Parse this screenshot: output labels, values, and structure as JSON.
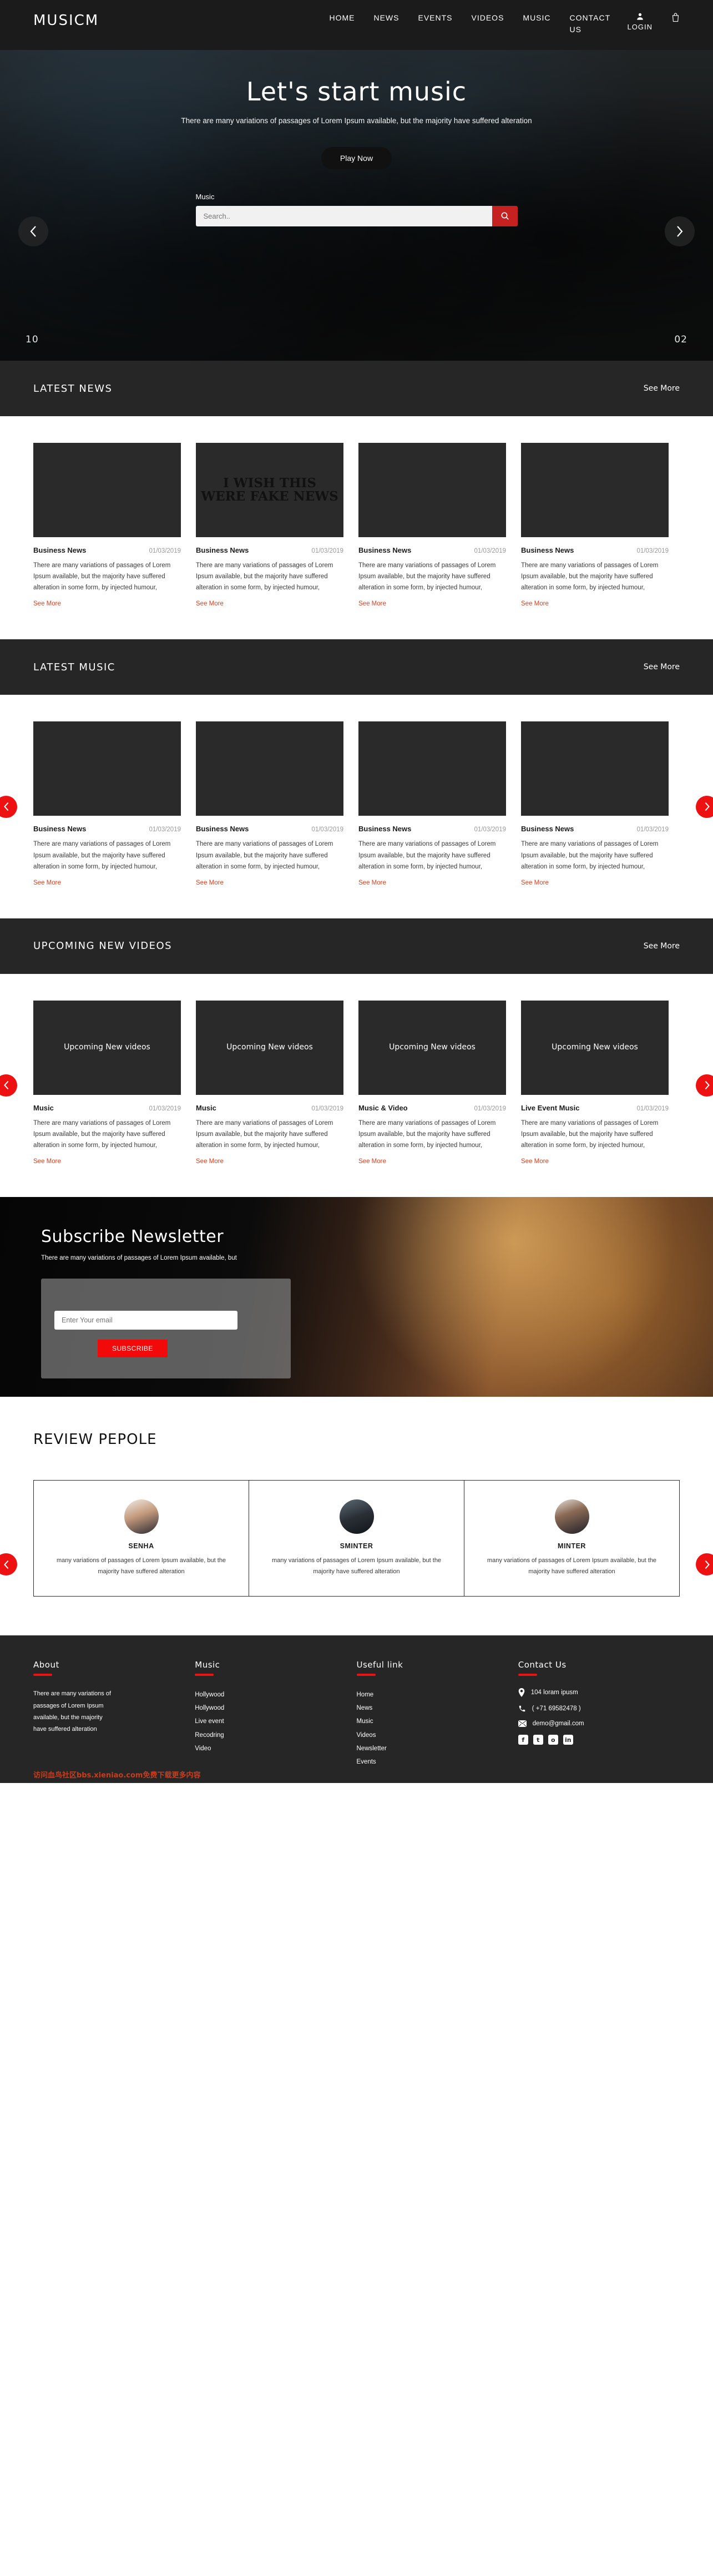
{
  "header": {
    "brand": "MUSICM",
    "nav": [
      {
        "label": "HOME"
      },
      {
        "label": "NEWS"
      },
      {
        "label": "EVENTS"
      },
      {
        "label": "VIDEOS"
      },
      {
        "label": "MUSIC"
      },
      {
        "label": "CONTACT US"
      }
    ],
    "account_label": "LOGIN",
    "account_icon": "user-icon",
    "cart_icon": "shopping-bag-icon"
  },
  "hero": {
    "title": "Let's start music",
    "subtitle": "There are many variations of passages of Lorem Ipsum available, but the majority have suffered alteration",
    "play_label": "Play Now",
    "search_label": "Music",
    "search_placeholder": "Search..",
    "search_value": "",
    "search_icon": "search-icon",
    "prev_icon": "chevron-left-icon",
    "next_icon": "chevron-right-icon",
    "slide_current": "10",
    "slide_total": "02"
  },
  "news_section": {
    "title": "LATEST NEWS",
    "more_label": "See More",
    "cards": [
      {
        "title": "Business News",
        "date": "01/03/2019",
        "body": "There are many variations of passages of Lorem Ipsum available, but the majority have suffered alteration in some form, by injected humour,",
        "link": "See More",
        "thumb": "newspaper-photo",
        "overlay": ""
      },
      {
        "title": "Business News",
        "date": "01/03/2019",
        "body": "There are many variations of passages of Lorem Ipsum available, but the majority have suffered alteration in some form, by injected humour,",
        "link": "See More",
        "thumb": "protest-sign-photo",
        "overlay": "I WISH THIS WERE FAKE NEWS"
      },
      {
        "title": "Business News",
        "date": "01/03/2019",
        "body": "There are many variations of passages of Lorem Ipsum available, but the majority have suffered alteration in some form, by injected humour,",
        "link": "See More",
        "thumb": "mixing-console-photo",
        "overlay": ""
      },
      {
        "title": "Business News",
        "date": "01/03/2019",
        "body": "There are many variations of passages of Lorem Ipsum available, but the majority have suffered alteration in some form, by injected humour,",
        "link": "See More",
        "thumb": "podcast-studio-photo",
        "overlay": ""
      }
    ]
  },
  "music_section": {
    "title": "LATEST MUSIC",
    "more_label": "See More",
    "prev_icon": "chevron-left-icon",
    "next_icon": "chevron-right-icon",
    "cards": [
      {
        "title": "Business News",
        "date": "01/03/2019",
        "body": "There are many variations of passages of Lorem Ipsum available, but the majority have suffered alteration in some form, by injected humour,",
        "link": "See More",
        "thumb": "concert-stage-photo"
      },
      {
        "title": "Business News",
        "date": "01/03/2019",
        "body": "There are many variations of passages of Lorem Ipsum available, but the majority have suffered alteration in some form, by injected humour,",
        "link": "See More",
        "thumb": "singer-photo"
      },
      {
        "title": "Business News",
        "date": "01/03/2019",
        "body": "There are many variations of passages of Lorem Ipsum available, but the majority have suffered alteration in some form, by injected humour,",
        "link": "See More",
        "thumb": "guitarist-photo"
      },
      {
        "title": "Business News",
        "date": "01/03/2019",
        "body": "There are many variations of passages of Lorem Ipsum available, but the majority have suffered alteration in some form, by injected humour,",
        "link": "See More",
        "thumb": "female-artist-photo"
      }
    ]
  },
  "videos_section": {
    "title": "UPCOMING NEW VIDEOS",
    "more_label": "See More",
    "prev_icon": "chevron-left-icon",
    "next_icon": "chevron-right-icon",
    "thumb_label": "Upcoming\nNew\nvideos",
    "cards": [
      {
        "title": "Music",
        "date": "01/03/2019",
        "body": "There are many variations of passages of Lorem Ipsum available, but the majority have suffered alteration in some form, by injected humour,",
        "link": "See More"
      },
      {
        "title": "Music",
        "date": "01/03/2019",
        "body": "There are many variations of passages of Lorem Ipsum available, but the majority have suffered alteration in some form, by injected humour,",
        "link": "See More"
      },
      {
        "title": "Music & Video",
        "date": "01/03/2019",
        "body": "There are many variations of passages of Lorem Ipsum available, but the majority have suffered alteration in some form, by injected humour,",
        "link": "See More"
      },
      {
        "title": "Live Event Music",
        "date": "01/03/2019",
        "body": "There are many variations of passages of Lorem Ipsum available, but the majority have suffered alteration in some form, by injected humour,",
        "link": "See More"
      }
    ]
  },
  "newsletter": {
    "title": "Subscribe Newsletter",
    "subtitle": "There are many variations of passages of Lorem Ipsum available, but",
    "email_placeholder": "Enter Your email",
    "email_value": "",
    "button_label": "SUBSCRIBE"
  },
  "reviews_section": {
    "title": "REVIEW PEPOLE",
    "prev_icon": "chevron-left-icon",
    "next_icon": "chevron-right-icon",
    "items": [
      {
        "name": "SENHA",
        "text": "many variations of passages of Lorem Ipsum available, but the majority have suffered alteration",
        "avatar": "man-portrait-photo"
      },
      {
        "name": "SMINTER",
        "text": "many variations of passages of Lorem Ipsum available, but the majority have suffered alteration",
        "avatar": "man-sunglasses-portrait-photo"
      },
      {
        "name": "MINTER",
        "text": "many variations of passages of Lorem Ipsum available, but the majority have suffered alteration",
        "avatar": "woman-portrait-photo"
      }
    ]
  },
  "footer": {
    "about": {
      "title": "About",
      "text": "There are many variations of passages of Lorem Ipsum available, but the majority have suffered alteration"
    },
    "music": {
      "title": "Music",
      "items": [
        "Hollywood",
        "Hollywood",
        "Live event",
        "Recodring",
        "Video"
      ]
    },
    "useful": {
      "title": "Useful link",
      "items": [
        "Home",
        "News",
        "Music",
        "Videos",
        "Newsletter",
        "Events"
      ]
    },
    "contact": {
      "title": "Contact Us",
      "address": "104 loram ipusm",
      "address_icon": "location-pin-icon",
      "phone": "( +71 69582478 )",
      "phone_icon": "phone-icon",
      "email": "demo@gmail.com",
      "email_icon": "envelope-icon",
      "socials": [
        {
          "name": "facebook-icon",
          "glyph": "f"
        },
        {
          "name": "twitter-icon",
          "glyph": "t"
        },
        {
          "name": "instagram-icon",
          "glyph": "o"
        },
        {
          "name": "linkedin-icon",
          "glyph": "in"
        }
      ]
    },
    "watermark": "访问血鸟社区bbs.xieniao.com免费下载更多内容"
  },
  "colors": {
    "accent_red": "#ee1111",
    "link_red": "#d8401e",
    "dark": "#262626",
    "header_dark": "#1b1b1b"
  }
}
